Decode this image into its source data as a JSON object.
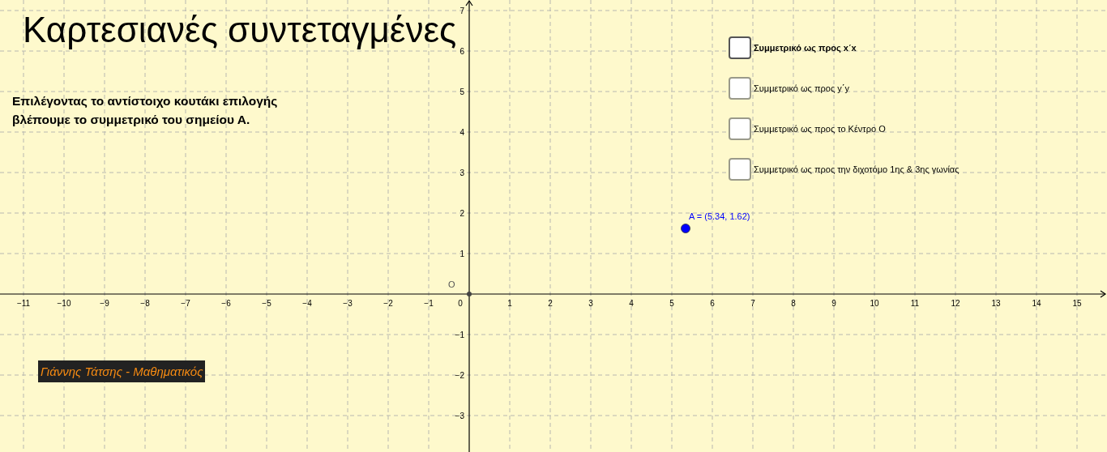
{
  "title": "Καρτεσιανές συντεταγμένες",
  "instructions": [
    "Επιλέγοντας το αντίστοιχο κουτάκι επιλογής",
    "βλέπουμε το συμμετρικό του σημείου Α."
  ],
  "checkboxes": [
    {
      "label": "Συμμετρικό ως προς x΄x",
      "checked": false,
      "focused": true
    },
    {
      "label": "Συμμετρικό ως προς y΄y",
      "checked": false,
      "focused": false
    },
    {
      "label": "Συμμετρικό ως προς το Κέντρο Ο",
      "checked": false,
      "focused": false
    },
    {
      "label": "Συμμετρικό ως προς την διχοτόμο 1ης & 3ης γωνίας",
      "checked": false,
      "focused": false
    }
  ],
  "author": "Γιάννης Τάτσης  - Μαθηματικός",
  "graph": {
    "origin_label": "O",
    "zero_label": "0",
    "point_label": "A = (5.34, 1.62)",
    "chart_data": {
      "type": "scatter",
      "grid": true,
      "xlim": [
        -11.58,
        15.74
      ],
      "ylim": [
        -3.9,
        7.26
      ],
      "xticks": [
        {
          "value": -11,
          "label": "−11"
        },
        {
          "value": -10,
          "label": "−10"
        },
        {
          "value": -9,
          "label": "−9"
        },
        {
          "value": -8,
          "label": "−8"
        },
        {
          "value": -7,
          "label": "−7"
        },
        {
          "value": -6,
          "label": "−6"
        },
        {
          "value": -5,
          "label": "−5"
        },
        {
          "value": -4,
          "label": "−4"
        },
        {
          "value": -3,
          "label": "−3"
        },
        {
          "value": -2,
          "label": "−2"
        },
        {
          "value": -1,
          "label": "−1"
        },
        1,
        2,
        3,
        4,
        5,
        6,
        7,
        8,
        9,
        10,
        11,
        12,
        13,
        14,
        15
      ],
      "yticks": [
        {
          "value": -3,
          "label": "−3"
        },
        {
          "value": -2,
          "label": "−2"
        },
        {
          "value": -1,
          "label": "−1"
        },
        1,
        2,
        3,
        4,
        5,
        6,
        7
      ],
      "x": [
        5.34
      ],
      "series": [
        {
          "color": "#0000ff",
          "values": [
            1.62
          ]
        }
      ]
    }
  }
}
